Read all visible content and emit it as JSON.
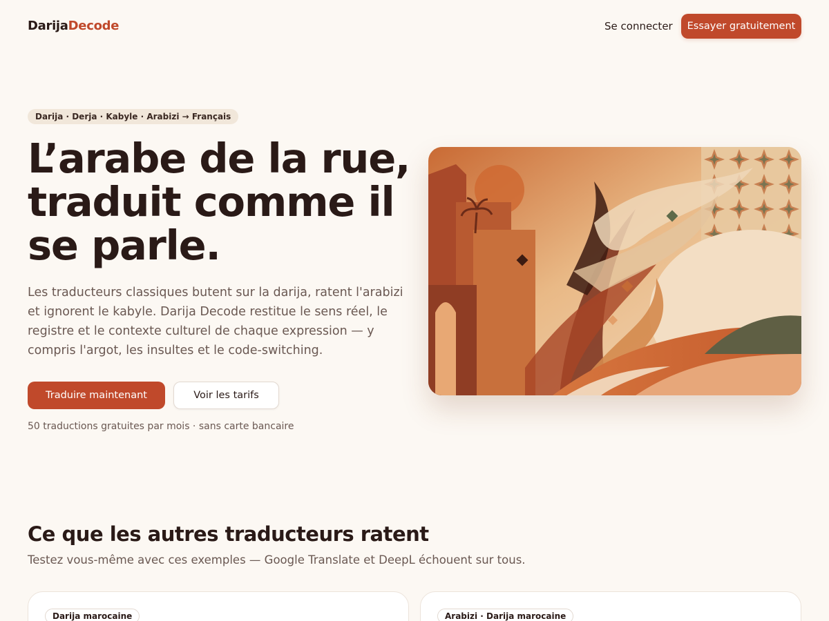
{
  "header": {
    "logo_part1": "Darija",
    "logo_part2": "Decode",
    "login_label": "Se connecter",
    "cta_label": "Essayer gratuitement"
  },
  "hero": {
    "pill": "Darija · Derja · Kabyle · Arabizi → Français",
    "title": "L’arabe de la rue, traduit comme il se parle.",
    "description": "Les traducteurs classiques butent sur la darija, ratent l'arabizi et ignorent le kabyle. Darija Decode restitue le sens réel, le registre et le contexte culturel de chaque expression — y compris l'argot, les insultes et le code-switching.",
    "primary_button": "Traduire maintenant",
    "secondary_button": "Voir les tarifs",
    "note": "50 traductions gratuites par mois · sans carte bancaire"
  },
  "section": {
    "title": "Ce que les autres traducteurs ratent",
    "subtitle": "Testez vous-même avec ces exemples — Google Translate et DeepL échouent sur tous.",
    "cards": [
      {
        "tag": "Darija marocaine"
      },
      {
        "tag": "Arabizi · Darija marocaine"
      }
    ]
  },
  "colors": {
    "accent": "#c0492b",
    "background": "#fcf8f3",
    "text": "#2a1a17"
  }
}
